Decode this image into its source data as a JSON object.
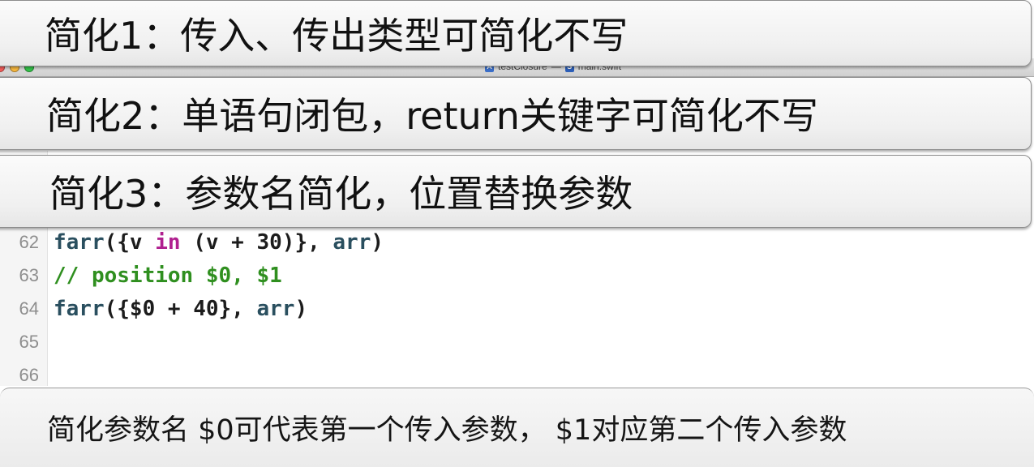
{
  "window": {
    "title_project": "testClosure",
    "title_separator": "—",
    "title_file": "main.swift",
    "project_icon": "xcode-project-icon",
    "file_icon": "swift-file-icon"
  },
  "captions": [
    {
      "text": "简化1：传入、传出类型可简化不写"
    },
    {
      "text": "简化2：单语句闭包，return关键字可简化不写"
    },
    {
      "text": "简化3：参数名简化，位置替换参数"
    }
  ],
  "code": {
    "lines": [
      {
        "number": "62",
        "tokens": [
          {
            "text": "farr",
            "kind": "fn"
          },
          {
            "text": "({v ",
            "kind": "plain"
          },
          {
            "text": "in",
            "kind": "kw"
          },
          {
            "text": " (v + 30)}, ",
            "kind": "plain"
          },
          {
            "text": "arr",
            "kind": "var"
          },
          {
            "text": ")",
            "kind": "plain"
          }
        ]
      },
      {
        "number": "63",
        "tokens": [
          {
            "text": "// position $0, $1",
            "kind": "comment"
          }
        ]
      },
      {
        "number": "64",
        "tokens": [
          {
            "text": "farr",
            "kind": "fn"
          },
          {
            "text": "({$0 + 40}, ",
            "kind": "plain"
          },
          {
            "text": "arr",
            "kind": "var"
          },
          {
            "text": ")",
            "kind": "plain"
          }
        ]
      },
      {
        "number": "65",
        "tokens": []
      },
      {
        "number": "66",
        "tokens": []
      }
    ]
  },
  "subtitle": {
    "text": "简化参数名 $0可代表第一个传入参数， $1对应第二个传入参数"
  },
  "colors": {
    "keyword": "#b0208f",
    "function": "#2a4f5f",
    "comment": "#2f8f1f",
    "line_number": "#8e8e8e"
  }
}
